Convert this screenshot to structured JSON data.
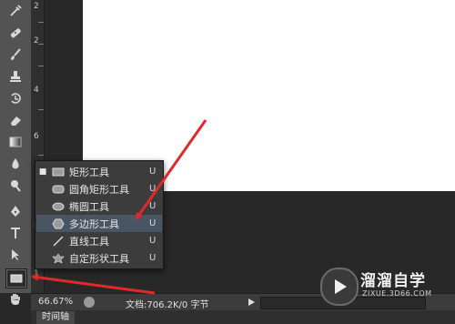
{
  "toolbar": {
    "tools": [
      {
        "icon": "eyedropper-icon"
      },
      {
        "icon": "healing-brush-icon"
      },
      {
        "icon": "brush-icon"
      },
      {
        "icon": "clone-stamp-icon"
      },
      {
        "icon": "history-brush-icon"
      },
      {
        "icon": "eraser-icon"
      },
      {
        "icon": "gradient-icon"
      },
      {
        "icon": "blur-icon"
      },
      {
        "icon": "dodge-icon"
      },
      {
        "icon": "pen-icon"
      },
      {
        "icon": "type-icon"
      },
      {
        "icon": "path-selection-icon"
      },
      {
        "icon": "rectangle-tool-icon",
        "active": true
      },
      {
        "icon": "hand-icon"
      }
    ]
  },
  "ruler": {
    "labels": [
      "2",
      "4",
      "6",
      "8",
      "1"
    ]
  },
  "flyout": {
    "items": [
      {
        "label": "矩形工具",
        "shortcut": "U",
        "icon": "rectangle-shape-icon",
        "current": true,
        "current_mark": "■",
        "selected": false
      },
      {
        "label": "圆角矩形工具",
        "shortcut": "U",
        "icon": "rounded-rectangle-icon",
        "current": false,
        "selected": false
      },
      {
        "label": "椭圆工具",
        "shortcut": "U",
        "icon": "ellipse-icon",
        "current": false,
        "selected": false
      },
      {
        "label": "多边形工具",
        "shortcut": "U",
        "icon": "polygon-icon",
        "current": false,
        "selected": true
      },
      {
        "label": "直线工具",
        "shortcut": "U",
        "icon": "line-icon",
        "current": false,
        "selected": false
      },
      {
        "label": "自定形状工具",
        "shortcut": "U",
        "icon": "custom-shape-icon",
        "current": false,
        "selected": false
      }
    ]
  },
  "status": {
    "zoom": "66.67%",
    "doc_info": "文档:706.2K/0 字节"
  },
  "timeline": {
    "tab_label": "时间轴"
  },
  "watermark": {
    "title": "溜溜自学",
    "subtitle": "ZIXUE.3D66.COM"
  },
  "colors": {
    "arrow": "#e02a2a",
    "menu_selected": "#4a5563",
    "toolbar_bg": "#535353"
  }
}
